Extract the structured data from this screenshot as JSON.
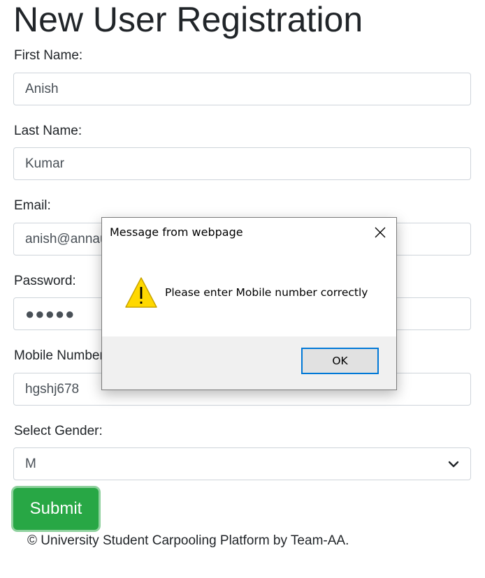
{
  "page": {
    "title": "New User Registration",
    "footer": "© University Student Carpooling Platform by Team-AA."
  },
  "form": {
    "first_name": {
      "label": "First Name:",
      "value": "Anish"
    },
    "last_name": {
      "label": "Last Name:",
      "value": "Kumar"
    },
    "email": {
      "label": "Email:",
      "value": "anish@annauniv.edu"
    },
    "password": {
      "label": "Password:",
      "value": "●●●●●"
    },
    "mobile": {
      "label": "Mobile Number:",
      "value": "hgshj678"
    },
    "gender": {
      "label": "Select Gender:",
      "value": "M"
    },
    "submit_label": "Submit"
  },
  "dialog": {
    "title": "Message from webpage",
    "message": "Please enter Mobile number correctly",
    "ok_label": "OK",
    "icon": "warning-icon"
  },
  "colors": {
    "submit_bg": "#28a745",
    "ok_border": "#0078d7",
    "warning_fill": "#ffd800"
  }
}
